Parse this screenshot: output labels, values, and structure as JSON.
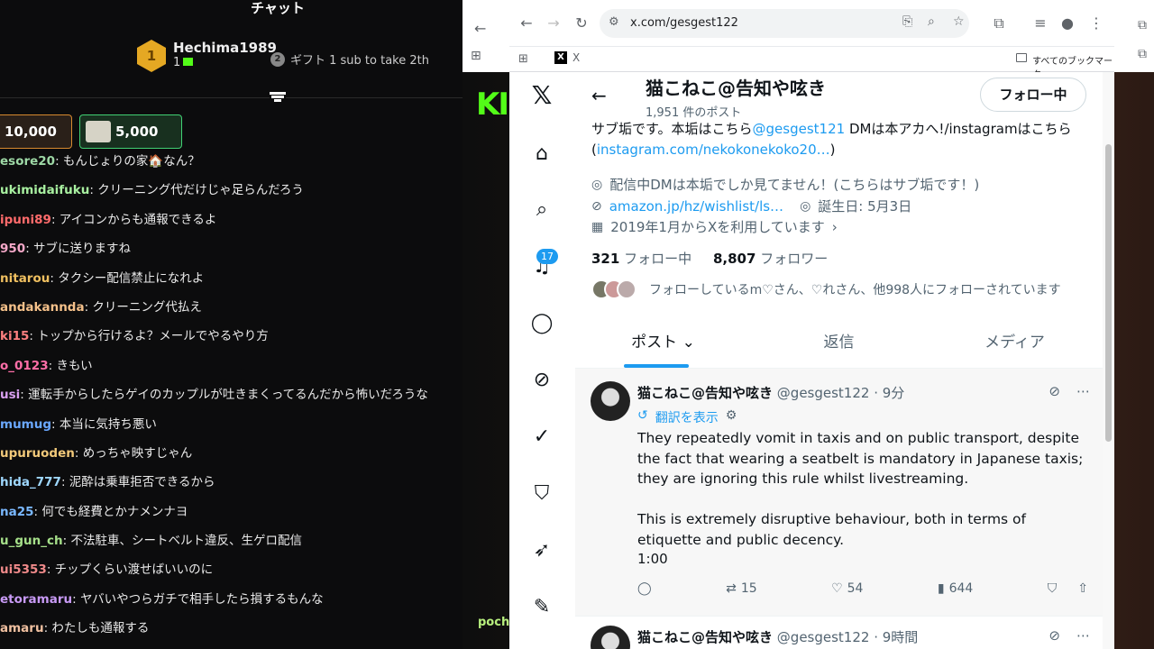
{
  "chat": {
    "title": "チャット",
    "top_gifter": {
      "rank": "1",
      "name": "Hechima1989",
      "count": "1"
    },
    "gift_promo": "ギフト 1 sub to take 2th",
    "promo_rank": "2",
    "pills": [
      {
        "value": "10,000"
      },
      {
        "value": "5,000"
      }
    ],
    "messages": [
      {
        "user": "esore20",
        "text": "もんじょりの家🏠なん？",
        "color": "#9ed9a6"
      },
      {
        "user": "ukimidaifuku",
        "text": "クリーニング代だけじゃ足らんだろう",
        "color": "#a8f0a0"
      },
      {
        "user": "ipuni89",
        "text": "アイコンからも通報できるよ",
        "color": "#ff6b6b"
      },
      {
        "user": "950",
        "text": "サブに送りますね",
        "color": "#f5a8c8"
      },
      {
        "user": "nitarou",
        "text": "タクシー配信禁止になれよ",
        "color": "#f0c060"
      },
      {
        "user": "andakannda",
        "text": "クリーニング代払え",
        "color": "#f5c18a"
      },
      {
        "user": "ki15",
        "text": "トップから行けるよ？メールでやるやり方",
        "color": "#ff8080"
      },
      {
        "user": "o_0123",
        "text": "きもい",
        "color": "#ff6fa8"
      },
      {
        "user": "usi",
        "text": "運転手からしたらゲイのカップルが吐きまくってるんだから怖いだろうな",
        "color": "#d9a0f0"
      },
      {
        "user": "mumug",
        "text": "本当に気持ち悪い",
        "color": "#6aa8ff"
      },
      {
        "user": "upuruoden",
        "text": "めっちゃ映すじゃん",
        "color": "#f2c97a"
      },
      {
        "user": "hida_777",
        "text": "泥酔は乗車拒否できるから",
        "color": "#9fd8ff"
      },
      {
        "user": "na25",
        "text": "何でも経費とかナメンナヨ",
        "color": "#7ab8ff"
      },
      {
        "user": "u_gun_ch",
        "text": "不法駐車、シートベルト違反、生ゲロ配信",
        "color": "#a6e08a"
      },
      {
        "user": "ui5353",
        "text": "チップくらい渡せばいいのに",
        "color": "#f08a8a"
      },
      {
        "user": "etoramaru",
        "text": "ヤバいやつらガチで相手したら損するもんな",
        "color": "#c89af5"
      },
      {
        "user": "amaru",
        "text": "わたしも通報する",
        "color": "#f0c0a0"
      }
    ]
  },
  "browser": {
    "url": "x.com/gesgest122",
    "bookmark_x": "X",
    "all_bookmarks": "すべてのブックマーク"
  },
  "stream": {
    "logo": "KI",
    "bottom_name": "poch"
  },
  "profile": {
    "name": "猫こねこ@告知や呟き",
    "posts": "1,951 件のポスト",
    "follow_button": "フォロー中",
    "bio_1": "サブ垢です。本垢はこちら",
    "bio_link": "@gesgest121",
    "bio_2": " DMは本アカへ!/instagramはこちら",
    "bio_3": "(",
    "bio_link2": "instagram.com/nekokonekoko20…",
    "bio_4": ")",
    "location": "配信中DMは本垢でしか見てません！(こちらはサブ垢です！)",
    "website": "amazon.jp/hz/wishlist/ls…",
    "birthday": "誕生日: 5月3日",
    "joined": "2019年1月からXを利用しています",
    "following_count": "321",
    "following_label": "フォロー中",
    "followers_count": "8,807",
    "followers_label": "フォロワー",
    "known_followers": "フォローしているm♡さん、♡れさん、他998人にフォローされています",
    "notifications": "17"
  },
  "tabs": [
    {
      "label": "ポスト ⌄"
    },
    {
      "label": "返信"
    },
    {
      "label": "メディア"
    }
  ],
  "tweet": {
    "name": "猫こねこ@告知や呟き",
    "handle": "@gesgest122 · 9分",
    "translate": "翻訳を表示",
    "text": "They repeatedly vomit in taxis and on public transport, despite the fact that wearing a seatbelt is mandatory in Japanese taxis; they are ignoring this rule whilst livestreaming.\n\nThis is extremely disruptive behaviour, both in terms of etiquette and public decency.",
    "time": "1:00",
    "retweets": "15",
    "likes": "54",
    "views": "644"
  },
  "tweet2": {
    "name": "猫こねこ@告知や呟き",
    "handle": "@gesgest122 · 9時間"
  }
}
